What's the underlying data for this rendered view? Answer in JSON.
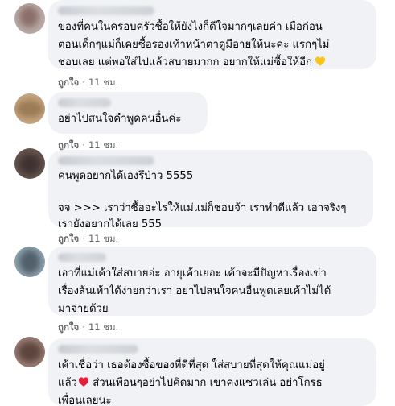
{
  "comments": [
    {
      "text": "ของที่คนในครอบครัวซื้อให้ยังไงก็ดีใจมากๆเลยค่า เมื่อก่อน\nตอนเด็กๆแม่ก็เคยซื้อรองเท้าหน้าตาดูมีอายให้นะคะ แรกๆไม่\nชอบเลย แต่พอใส่ไปแล้วสบายมากก อยากให้แม่ซื้อให้อีก",
      "emoji": "yellow-heart",
      "like": "ถูกใจ",
      "time": "11 ชม."
    },
    {
      "text": "อย่าไปสนใจคำพูดคนอื่นค่ะ",
      "like": "ถูกใจ",
      "time": "11 ชม."
    },
    {
      "text": "คนพูดอยากได้เองรึป่าว 5555\n\nจจ >>> เราว่าซื้ออะไรให้แม่แม่ก็ชอบจ้า เราทำดีแล้ว เอาจริงๆ\nเรายังอยากได้เลย 555",
      "like": "ถูกใจ",
      "time": "11 ชม."
    },
    {
      "text": "เอาที่แม่เค้าใส่สบายอ่ะ อายุเค้าเยอะ เค้าจะมีปัญหาเรื่องเข่า\nเรื่องส้นเท้าได้ง่ายกว่าเรา อย่าไปสนใจคนอื่นพูดเลยเค้าไม่ได้\nมาจ่ายด้วย",
      "like": "ถูกใจ",
      "time": "11 ชม."
    },
    {
      "text": "เค้าเชื่อว่า เธอต้องซื้อของที่ดีที่สุด ใส่สบายที่สุดให้คุณแม่อยู่\nแล้ว",
      "emoji_inline": "red-heart",
      "text_after": " ส่วนเพื่อนๆอย่าไปคิดมาก เขาคงแซวเล่น อย่าโกรธ\nเพื่อนเลยนะ"
    }
  ],
  "colors": {
    "bubble": "#f0f2f5",
    "text": "#050505",
    "meta": "#65676b",
    "yellow_heart": "#f7c51e",
    "red_heart": "#e0203a"
  }
}
